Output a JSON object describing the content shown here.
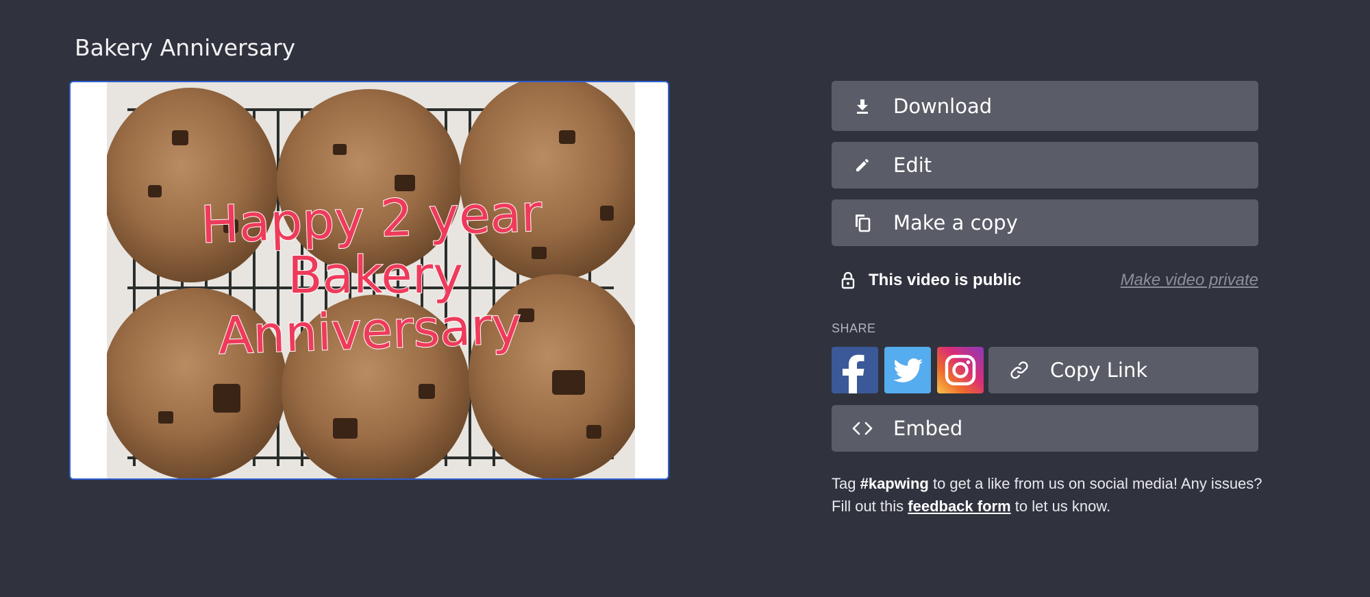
{
  "project": {
    "title": "Bakery Anniversary"
  },
  "preview": {
    "overlay_lines": [
      "Happy 2 year",
      "Bakery",
      "Anniversary"
    ],
    "overlay_color": "#ee3b5b"
  },
  "actions": {
    "download": {
      "label": "Download",
      "icon": "download-icon"
    },
    "edit": {
      "label": "Edit",
      "icon": "pencil-icon"
    },
    "copy": {
      "label": "Make a copy",
      "icon": "copy-icon"
    }
  },
  "privacy": {
    "status": "This video is public",
    "toggle": "Make video private",
    "icon": "lock-icon"
  },
  "share": {
    "label": "SHARE",
    "networks": [
      {
        "name": "facebook",
        "icon": "facebook-icon",
        "color": "#3b5998"
      },
      {
        "name": "twitter",
        "icon": "twitter-icon",
        "color": "#55acee"
      },
      {
        "name": "instagram",
        "icon": "instagram-icon",
        "color": "#d92e77"
      }
    ],
    "copy_link": {
      "label": "Copy Link",
      "icon": "link-icon"
    }
  },
  "embed": {
    "label": "Embed",
    "icon": "code-icon"
  },
  "footer": {
    "t1": "Tag ",
    "hashtag": "#kapwing",
    "t2": " to get a like from us on social media! Any issues? Fill out this ",
    "link": "feedback form",
    "t3": " to let us know."
  },
  "colors": {
    "background": "#30333e",
    "button": "#5a5c67",
    "preview_border": "#2f5fd1"
  }
}
